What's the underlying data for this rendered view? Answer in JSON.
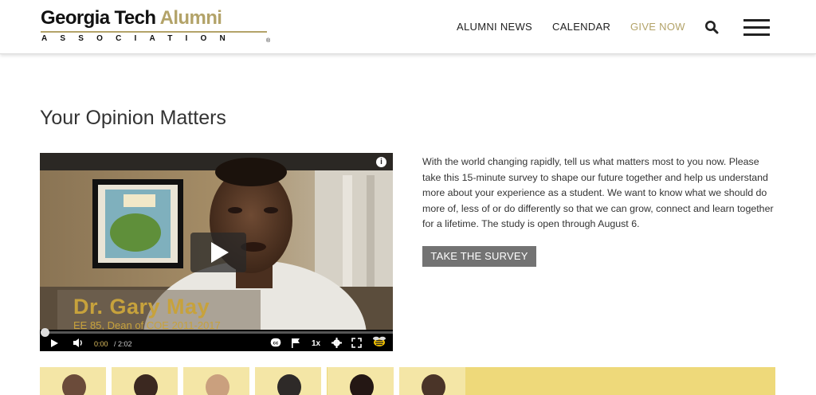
{
  "header": {
    "logo": {
      "line1_part1": "Georgia Tech",
      "line1_part2": "Alumni",
      "line2": "ASSOCIATION",
      "reg": "®"
    },
    "nav": [
      "ALUMNI NEWS",
      "CALENDAR",
      "GIVE NOW"
    ],
    "icons": [
      "search-icon",
      "hamburger-menu-icon"
    ]
  },
  "colors": {
    "gold": "#b3a369",
    "button": "#737373",
    "strip": "#eed97a"
  },
  "main": {
    "title": "Your Opinion Matters",
    "video": {
      "name_overlay": "Dr. Gary May",
      "subtitle_overlay": "EE 85, Dean of COE 2011-2017",
      "current_time": "0:00",
      "duration": "/ 2:02",
      "speed": "1x",
      "progress": 0.0
    },
    "description": "With the world changing rapidly, tell us what matters most to you now. Please take this 15-minute survey to shape our future together and help us understand more about your experience as a student. We want to know what we should do more of, less of or do differently so that we can grow, connect and learn together for a lifetime. The study is open through August 6.",
    "survey_button": "TAKE THE SURVEY"
  }
}
